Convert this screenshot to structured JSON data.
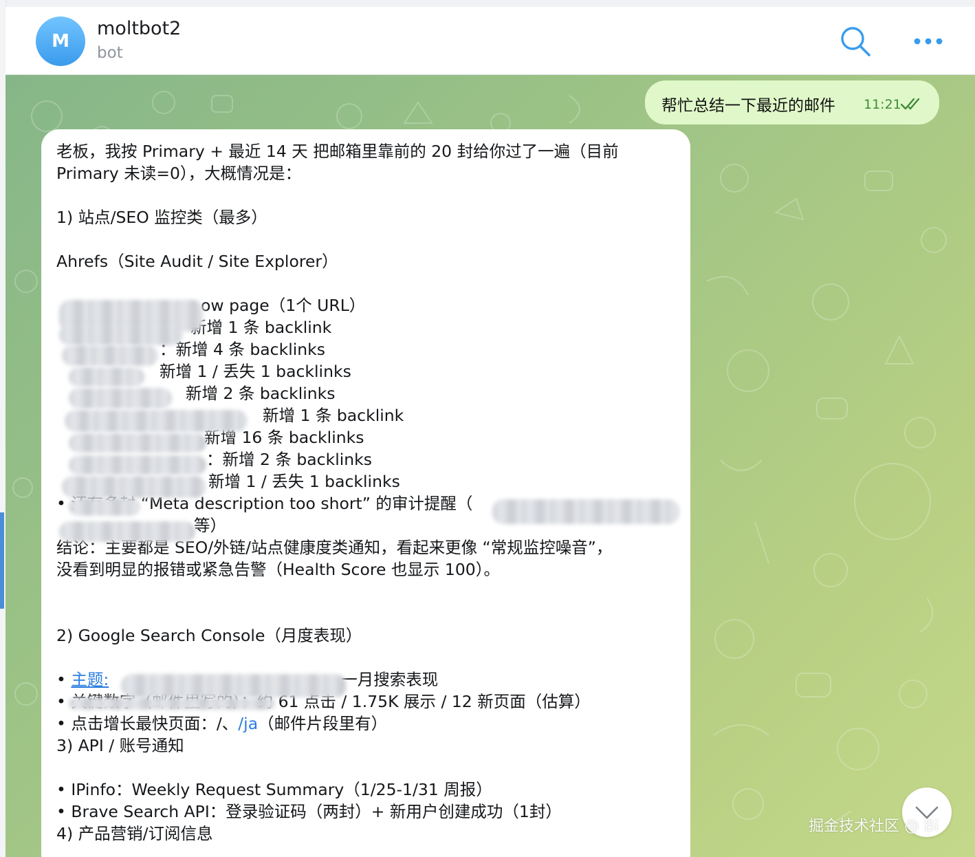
{
  "header": {
    "avatar_letter": "M",
    "title": "moltbot2",
    "subtitle": "bot"
  },
  "colors": {
    "accent": "#3a9bec",
    "outgoing_bubble": "#e0f8c9",
    "incoming_bubble": "#ffffff",
    "link": "#2a7de1",
    "read_ticks": "#3f8a3a"
  },
  "icons": {
    "search": "search-icon",
    "more": "more-dots-icon",
    "read_receipt": "double-check-icon",
    "scroll_down": "chevron-down-icon"
  },
  "outgoing": {
    "text": "帮忙总结一下最近的邮件",
    "time": "11:21"
  },
  "incoming": {
    "lines": {
      "l1": "老板，我按 Primary + 最近 14 天 把邮箱里靠前的 20 封给你过了一遍（目前",
      "l2": "Primary 未读=0），大概情况是：",
      "l3": "1) 站点/SEO 监控类（最多）",
      "l4": "Ahrefs（Site Audit / Site Explorer）",
      "b1": "ow page（1个 URL）",
      "b2": "新增 1 条 backlink",
      "b3": "：新增 4 条 backlinks",
      "b4": "新增 1 / 丢失 1 backlinks",
      "b5": "新增 2 条 backlinks",
      "b6": "新增 1 条 backlink",
      "b7": "新增 16 条 backlinks",
      "b8": "：新增 2 条 backlinks",
      "b9": "新增 1 / 丢失 1 backlinks",
      "b10": "还有多封 “Meta description too short” 的审计提醒（",
      "b10b": "等）",
      "c1": "结论：主要都是 SEO/外链/站点健康度类通知，看起来更像 “常规监控噪音”，",
      "c2": "没看到明显的报错或紧急告警（Health Score 也显示 100）。",
      "s2": "2) Google Search Console（月度表现）",
      "g1_link": "主题:",
      "g1_rest": "一月搜索表现",
      "g2": "关键数字（邮件里写的）：约 61 点击 / 1.75K 展示 / 12 新页面（估算）",
      "g3_a": "点击增长最快页面：/、",
      "g3_link": "/ja",
      "g3_b": "（邮件片段里有）",
      "s3": "3) API / 账号通知",
      "a1": "IPinfo：Weekly Request Summary（1/25-1/31 周报）",
      "a2": "Brave Search API：登录验证码（两封）+ 新用户创建成功（1封）",
      "s4": "4) 产品营销/订阅信息"
    }
  },
  "watermark": "掘金技术社区 @ Bi"
}
